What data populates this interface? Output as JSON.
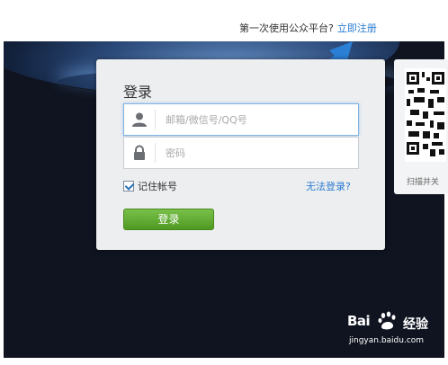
{
  "header": {
    "prompt": "第一次使用公众平台?",
    "register_link": "立即注册"
  },
  "login": {
    "title": "登录",
    "account_placeholder": "邮箱/微信号/QQ号",
    "password_placeholder": "密码",
    "remember_label": "记住帐号",
    "remember_checked": true,
    "forgot_link": "无法登录?",
    "submit_label": "登录"
  },
  "qr": {
    "caption": "扫描并关"
  },
  "watermark": {
    "brand": "Bai",
    "product": "经验",
    "url": "jingyan.baidu.com"
  },
  "colors": {
    "link": "#2a7bd1",
    "button": "#5aa62b",
    "arrow": "#2b7fd4",
    "background": "#0f1420"
  },
  "icons": {
    "account": "user-icon",
    "password": "lock-icon",
    "arrow": "annotation-arrow-icon"
  }
}
